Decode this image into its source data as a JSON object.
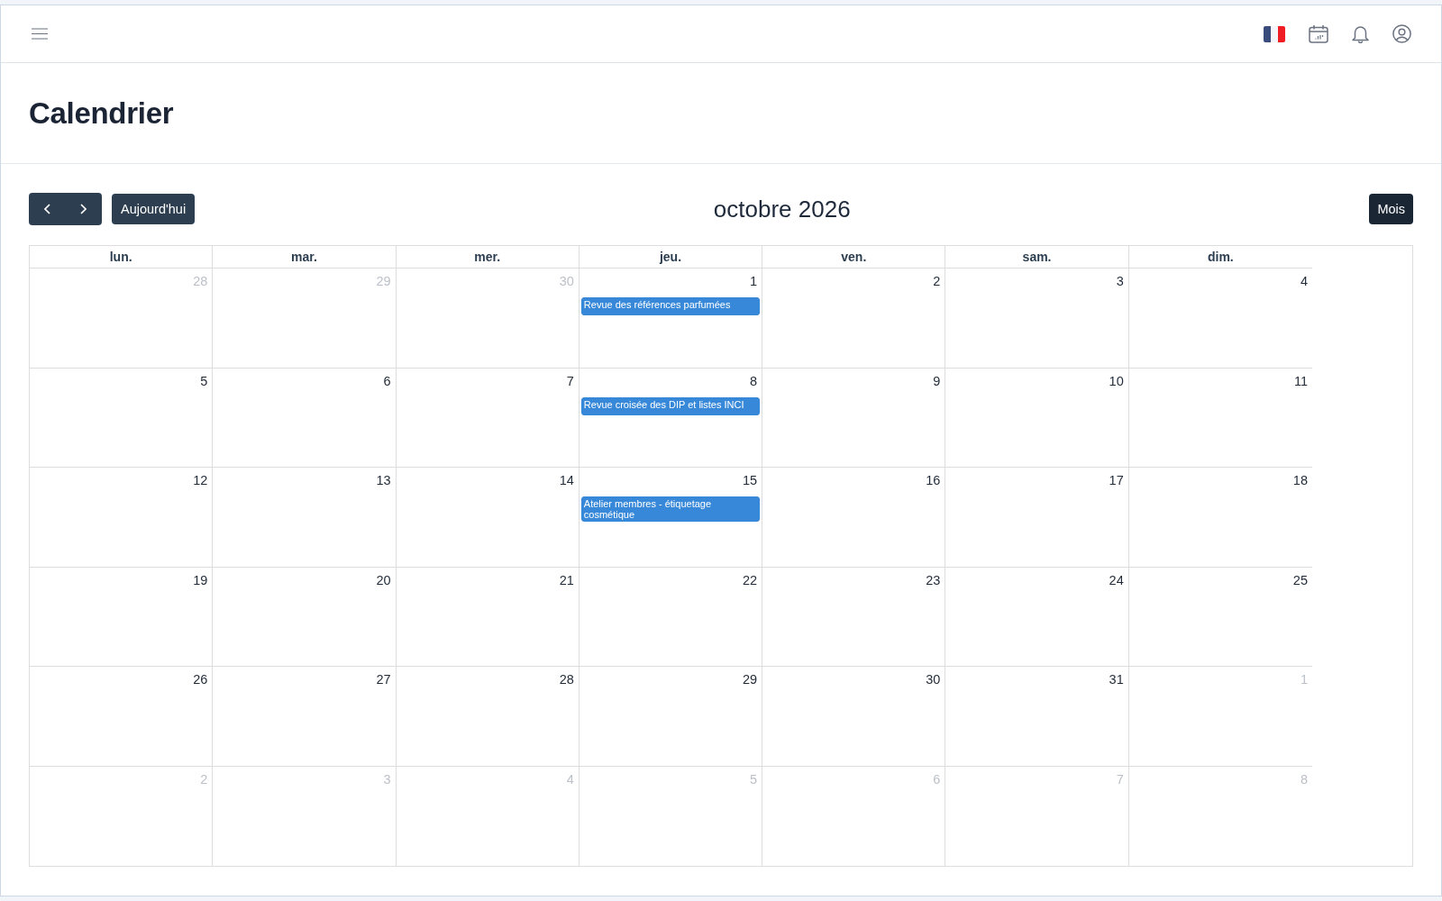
{
  "page": {
    "title": "Calendrier"
  },
  "toolbar": {
    "today_button": "Aujourd'hui",
    "title": "octobre 2026",
    "views": [
      {
        "label": "Mois",
        "selected": true
      }
    ]
  },
  "calendar": {
    "weekdays": [
      "lun.",
      "mar.",
      "mer.",
      "jeu.",
      "ven.",
      "sam.",
      "dim."
    ],
    "weeks": [
      {
        "days": [
          {
            "day": "28",
            "other_month": true
          },
          {
            "day": "29",
            "other_month": true
          },
          {
            "day": "30",
            "other_month": true
          },
          {
            "day": "1",
            "other_month": false,
            "events": [
              {
                "title": "Revue des références parfumées"
              }
            ]
          },
          {
            "day": "2",
            "other_month": false
          },
          {
            "day": "3",
            "other_month": false
          },
          {
            "day": "4",
            "other_month": false
          }
        ]
      },
      {
        "days": [
          {
            "day": "5",
            "other_month": false
          },
          {
            "day": "6",
            "other_month": false
          },
          {
            "day": "7",
            "other_month": false
          },
          {
            "day": "8",
            "other_month": false,
            "events": [
              {
                "title": "Revue croisée des DIP et listes INCI"
              }
            ]
          },
          {
            "day": "9",
            "other_month": false
          },
          {
            "day": "10",
            "other_month": false
          },
          {
            "day": "11",
            "other_month": false
          }
        ]
      },
      {
        "days": [
          {
            "day": "12",
            "other_month": false
          },
          {
            "day": "13",
            "other_month": false
          },
          {
            "day": "14",
            "other_month": false
          },
          {
            "day": "15",
            "other_month": false,
            "events": [
              {
                "title": "Atelier membres - étiquetage cosmétique"
              }
            ]
          },
          {
            "day": "16",
            "other_month": false
          },
          {
            "day": "17",
            "other_month": false
          },
          {
            "day": "18",
            "other_month": false
          }
        ]
      },
      {
        "days": [
          {
            "day": "19",
            "other_month": false
          },
          {
            "day": "20",
            "other_month": false
          },
          {
            "day": "21",
            "other_month": false
          },
          {
            "day": "22",
            "other_month": false
          },
          {
            "day": "23",
            "other_month": false
          },
          {
            "day": "24",
            "other_month": false
          },
          {
            "day": "25",
            "other_month": false
          }
        ]
      },
      {
        "days": [
          {
            "day": "26",
            "other_month": false
          },
          {
            "day": "27",
            "other_month": false
          },
          {
            "day": "28",
            "other_month": false
          },
          {
            "day": "29",
            "other_month": false
          },
          {
            "day": "30",
            "other_month": false
          },
          {
            "day": "31",
            "other_month": false
          },
          {
            "day": "1",
            "other_month": true
          }
        ]
      },
      {
        "days": [
          {
            "day": "2",
            "other_month": true
          },
          {
            "day": "3",
            "other_month": true
          },
          {
            "day": "4",
            "other_month": true
          },
          {
            "day": "5",
            "other_month": true
          },
          {
            "day": "6",
            "other_month": true
          },
          {
            "day": "7",
            "other_month": true
          },
          {
            "day": "8",
            "other_month": true
          }
        ]
      }
    ]
  }
}
